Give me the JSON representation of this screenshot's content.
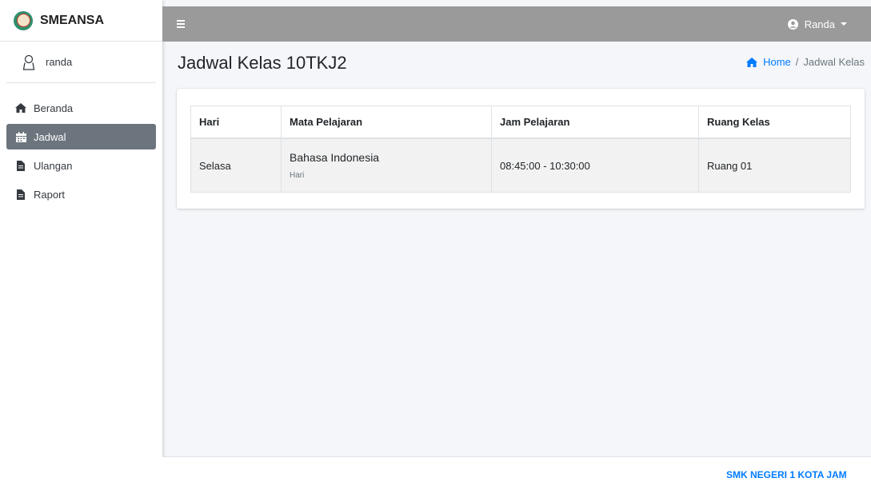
{
  "brand": {
    "name": "SMEANSA"
  },
  "user_panel": {
    "username": "randa"
  },
  "sidebar": {
    "items": [
      {
        "label": "Beranda",
        "icon": "home-icon",
        "active": false
      },
      {
        "label": "Jadwal",
        "icon": "calendar-icon",
        "active": true
      },
      {
        "label": "Ulangan",
        "icon": "file-icon",
        "active": false
      },
      {
        "label": "Raport",
        "icon": "file-icon",
        "active": false
      }
    ]
  },
  "topbar": {
    "menu_icon": "hamburger-icon",
    "user_label": "Randa",
    "user_icon": "user-circle-icon"
  },
  "page": {
    "title": "Jadwal Kelas 10TKJ2",
    "breadcrumb": {
      "home": "Home",
      "separator": "/",
      "current": "Jadwal Kelas"
    }
  },
  "table": {
    "headers": [
      "Hari",
      "Mata Pelajaran",
      "Jam Pelajaran",
      "Ruang Kelas"
    ],
    "rows": [
      {
        "hari": "Selasa",
        "mapel": "Bahasa Indonesia",
        "mapel_sub": "Hari",
        "jam": "08:45:00 - 10:30:00",
        "ruang": "Ruang 01"
      }
    ]
  },
  "footer": {
    "text": "SMK NEGERI 1 KOTA JAM"
  },
  "colors": {
    "accent": "#007bff",
    "topbar": "#9a9a9a",
    "active_nav": "#6c757d",
    "background": "#f4f6f9"
  }
}
